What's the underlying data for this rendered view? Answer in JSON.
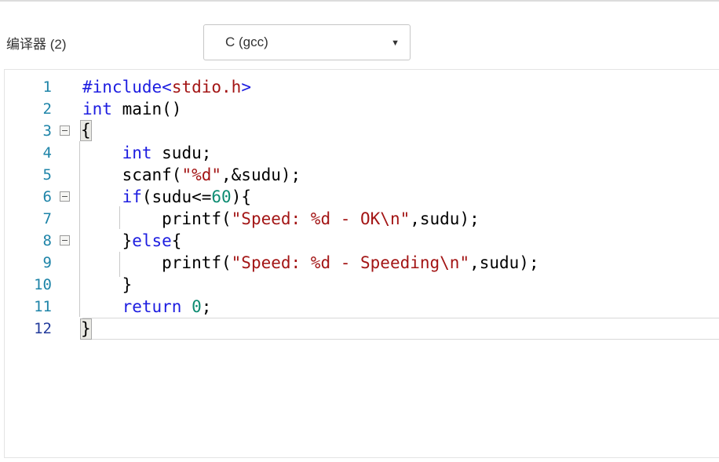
{
  "header": {
    "label": "编译器 (2)",
    "compiler_dropdown": {
      "value": "C (gcc)"
    }
  },
  "icons": {
    "dropdown_arrow": "▼",
    "fold_collapse": "minus-box"
  },
  "colors": {
    "keyword": "#1d1de0",
    "string": "#a31515",
    "number": "#0d8c72",
    "plain": "#000000",
    "line_number": "#1e84a8",
    "active_line_number": "#223a9b",
    "fold_guide": "#c9c9c9"
  },
  "editor": {
    "language": "c",
    "active_line": 12,
    "lines": [
      {
        "n": "1",
        "fold": false,
        "tokens": [
          {
            "t": "kw",
            "s": "#include"
          },
          {
            "t": "kw",
            "s": "<"
          },
          {
            "t": "str",
            "s": "stdio.h"
          },
          {
            "t": "kw",
            "s": ">"
          }
        ]
      },
      {
        "n": "2",
        "fold": false,
        "tokens": [
          {
            "t": "kw",
            "s": "int"
          },
          {
            "t": "pl",
            "s": " main()"
          }
        ]
      },
      {
        "n": "3",
        "fold": true,
        "tokens": [
          {
            "t": "brace",
            "s": "{"
          }
        ]
      },
      {
        "n": "4",
        "fold": false,
        "tokens": [
          {
            "t": "pl",
            "s": "    "
          },
          {
            "t": "kw",
            "s": "int"
          },
          {
            "t": "pl",
            "s": " sudu;"
          }
        ]
      },
      {
        "n": "5",
        "fold": false,
        "tokens": [
          {
            "t": "pl",
            "s": "    scanf("
          },
          {
            "t": "str",
            "s": "\"%d\""
          },
          {
            "t": "pl",
            "s": ",&sudu);"
          }
        ]
      },
      {
        "n": "6",
        "fold": true,
        "tokens": [
          {
            "t": "pl",
            "s": "    "
          },
          {
            "t": "kw",
            "s": "if"
          },
          {
            "t": "pl",
            "s": "(sudu<="
          },
          {
            "t": "num",
            "s": "60"
          },
          {
            "t": "pl",
            "s": "){"
          }
        ]
      },
      {
        "n": "7",
        "fold": false,
        "tokens": [
          {
            "t": "pl",
            "s": "        printf("
          },
          {
            "t": "str",
            "s": "\"Speed: %d - OK\\n\""
          },
          {
            "t": "pl",
            "s": ",sudu);"
          }
        ]
      },
      {
        "n": "8",
        "fold": true,
        "tokens": [
          {
            "t": "pl",
            "s": "    }"
          },
          {
            "t": "kw",
            "s": "else"
          },
          {
            "t": "pl",
            "s": "{"
          }
        ]
      },
      {
        "n": "9",
        "fold": false,
        "tokens": [
          {
            "t": "pl",
            "s": "        printf("
          },
          {
            "t": "str",
            "s": "\"Speed: %d - Speeding\\n\""
          },
          {
            "t": "pl",
            "s": ",sudu);"
          }
        ]
      },
      {
        "n": "10",
        "fold": false,
        "tokens": [
          {
            "t": "pl",
            "s": "    }"
          }
        ]
      },
      {
        "n": "11",
        "fold": false,
        "tokens": [
          {
            "t": "pl",
            "s": "    "
          },
          {
            "t": "kw",
            "s": "return"
          },
          {
            "t": "pl",
            "s": " "
          },
          {
            "t": "num",
            "s": "0"
          },
          {
            "t": "pl",
            "s": ";"
          }
        ]
      },
      {
        "n": "12",
        "fold": false,
        "tokens": [
          {
            "t": "brace",
            "s": "}"
          }
        ]
      }
    ]
  }
}
